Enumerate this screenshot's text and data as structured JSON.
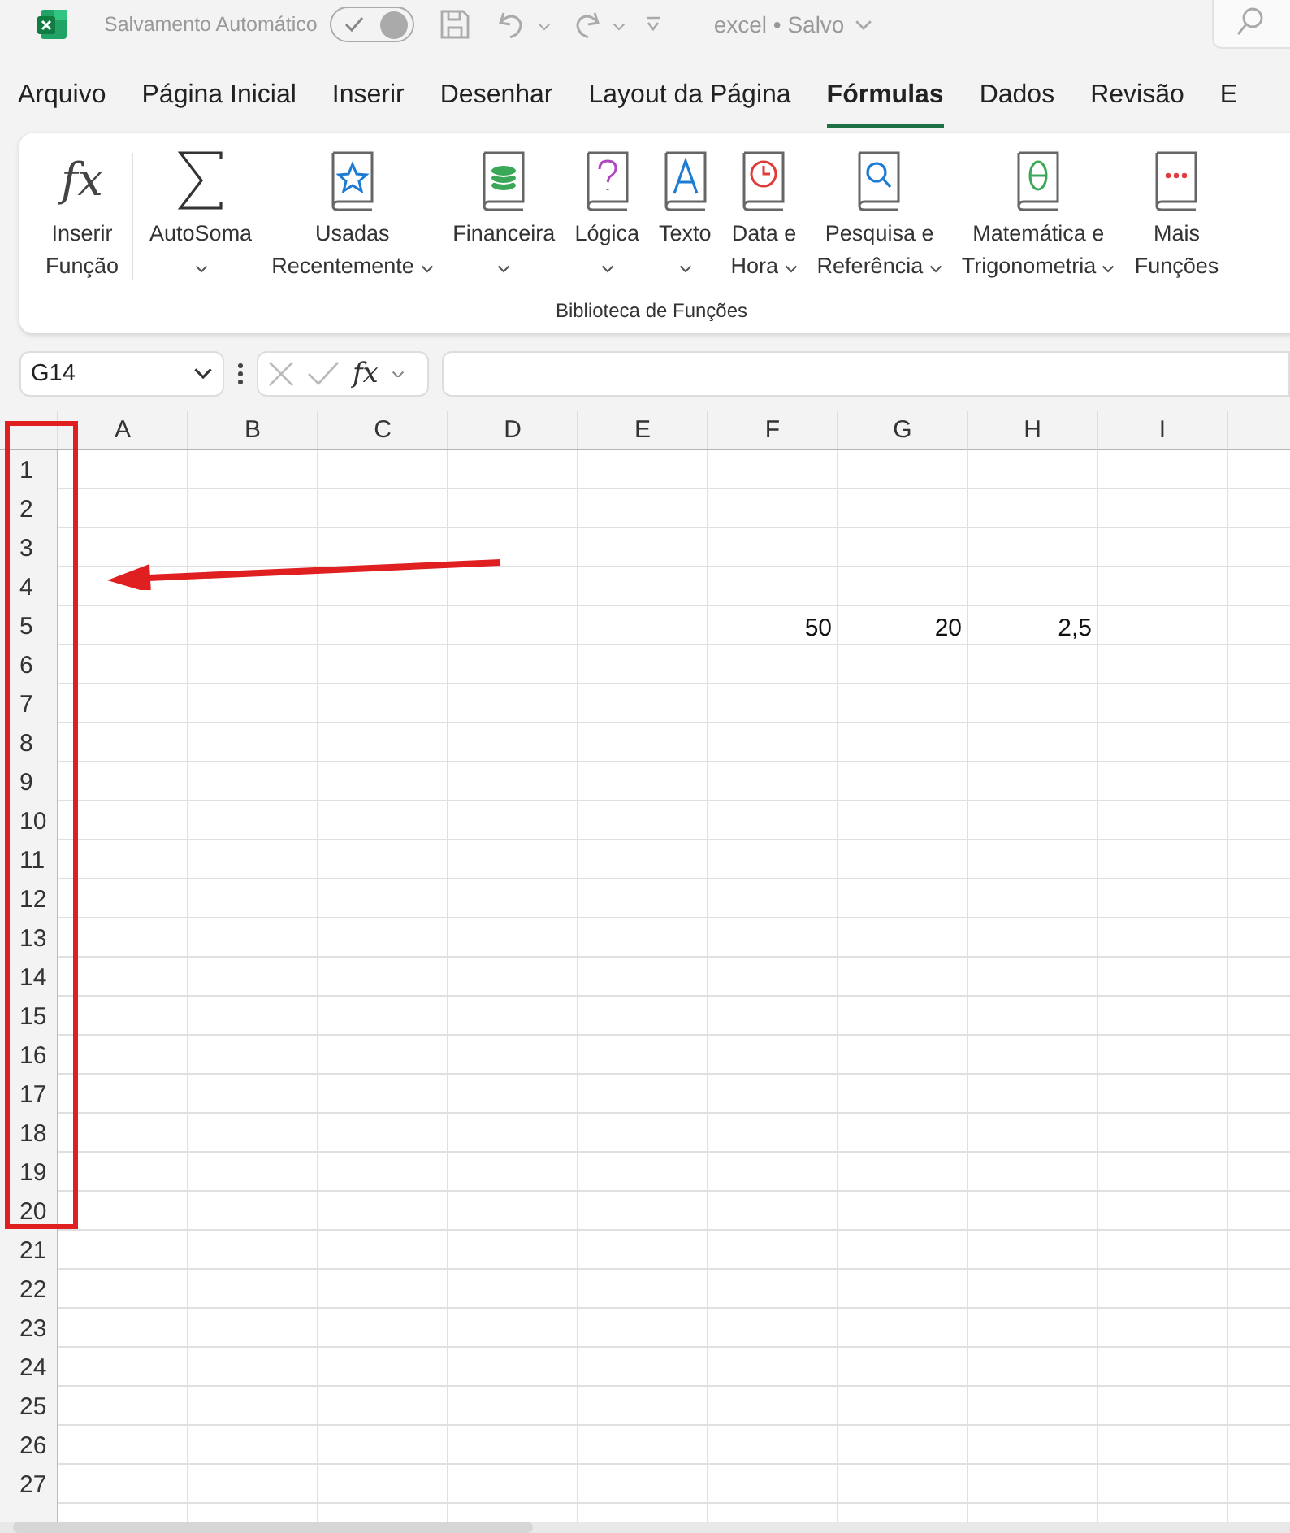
{
  "title_bar": {
    "autosave": {
      "label": "Salvamento Automático",
      "on": true
    },
    "document": "excel • Salvo"
  },
  "menu_tabs": [
    {
      "label": "Arquivo",
      "selected": false
    },
    {
      "label": "Página Inicial",
      "selected": false
    },
    {
      "label": "Inserir",
      "selected": false
    },
    {
      "label": "Desenhar",
      "selected": false
    },
    {
      "label": "Layout da Página",
      "selected": false
    },
    {
      "label": "Fórmulas",
      "selected": true
    },
    {
      "label": "Dados",
      "selected": false
    },
    {
      "label": "Revisão",
      "selected": false
    },
    {
      "label": "E",
      "selected": false
    }
  ],
  "ribbon": {
    "group_label": "Biblioteca de Funções",
    "buttons": [
      {
        "kind": "glyph",
        "glyph": "fx",
        "lines": [
          "Inserir",
          "Função"
        ],
        "dropdown": false
      },
      {
        "kind": "sigma",
        "lines": [
          "AutoSoma"
        ],
        "dropdown": true
      },
      {
        "kind": "star",
        "lines": [
          "Usadas",
          "Recentemente"
        ],
        "dropdown": true
      },
      {
        "kind": "coins",
        "lines": [
          "Financeira"
        ],
        "dropdown": true
      },
      {
        "kind": "question",
        "lines": [
          "Lógica"
        ],
        "dropdown": true
      },
      {
        "kind": "letter",
        "lines": [
          "Texto"
        ],
        "dropdown": true
      },
      {
        "kind": "clock",
        "lines": [
          "Data e",
          "Hora"
        ],
        "dropdown": true
      },
      {
        "kind": "magnifier",
        "lines": [
          "Pesquisa e",
          "Referência"
        ],
        "dropdown": true
      },
      {
        "kind": "theta",
        "lines": [
          "Matemática e",
          "Trigonometria"
        ],
        "dropdown": true
      },
      {
        "kind": "dots",
        "lines": [
          "Mais",
          "Funções"
        ],
        "dropdown": false
      }
    ]
  },
  "formula_bar": {
    "name_box": "G14",
    "fx_label": "fx"
  },
  "sheet": {
    "columns": [
      "A",
      "B",
      "C",
      "D",
      "E",
      "F",
      "G",
      "H",
      "I"
    ],
    "rows": [
      {
        "header": "1"
      },
      {
        "header": "2"
      },
      {
        "header": "3"
      },
      {
        "header": "4"
      },
      {
        "header": "5",
        "cells": [
          null,
          null,
          null,
          null,
          null,
          "50",
          "20",
          "2,5",
          null
        ]
      },
      {
        "header": "6"
      },
      {
        "header": "7"
      },
      {
        "header": "8"
      },
      {
        "header": "9"
      },
      {
        "header": "10"
      },
      {
        "header": "11"
      },
      {
        "header": "12"
      },
      {
        "header": "13"
      },
      {
        "header": "14"
      },
      {
        "header": "15"
      },
      {
        "header": "16"
      },
      {
        "header": "17"
      },
      {
        "header": "18"
      },
      {
        "header": "19"
      },
      {
        "header": "20"
      },
      {
        "header": "21"
      },
      {
        "header": "22"
      },
      {
        "header": "23"
      },
      {
        "header": "24"
      },
      {
        "header": "25"
      },
      {
        "header": "26"
      },
      {
        "header": "27"
      }
    ]
  }
}
